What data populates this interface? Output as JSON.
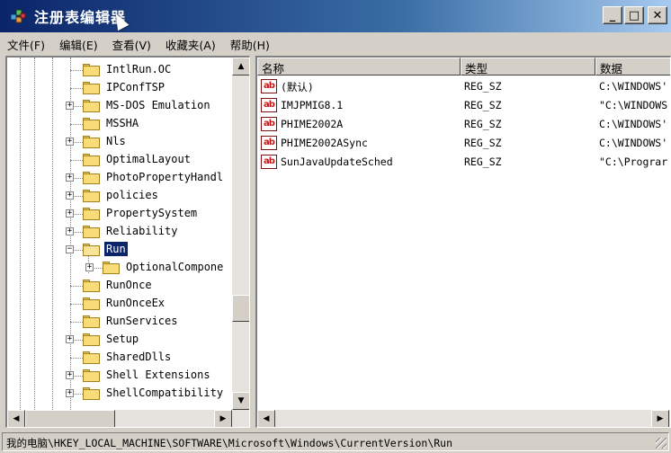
{
  "window": {
    "title": "注册表编辑器",
    "minimize_label": "_",
    "maximize_label": "□",
    "close_label": "✕"
  },
  "menu": [
    {
      "label": "文件(F)"
    },
    {
      "label": "编辑(E)"
    },
    {
      "label": "查看(V)"
    },
    {
      "label": "收藏夹(A)"
    },
    {
      "label": "帮助(H)"
    }
  ],
  "tree": {
    "items": [
      {
        "label": "IntlRun.OC",
        "expander": "",
        "depth": 0
      },
      {
        "label": "IPConfTSP",
        "expander": "",
        "depth": 0
      },
      {
        "label": "MS-DOS Emulation",
        "expander": "+",
        "depth": 0
      },
      {
        "label": "MSSHA",
        "expander": "",
        "depth": 0
      },
      {
        "label": "Nls",
        "expander": "+",
        "depth": 0
      },
      {
        "label": "OptimalLayout",
        "expander": "",
        "depth": 0
      },
      {
        "label": "PhotoPropertyHandl",
        "expander": "+",
        "depth": 0
      },
      {
        "label": "policies",
        "expander": "+",
        "depth": 0
      },
      {
        "label": "PropertySystem",
        "expander": "+",
        "depth": 0
      },
      {
        "label": "Reliability",
        "expander": "+",
        "depth": 0
      },
      {
        "label": "Run",
        "expander": "−",
        "depth": 0,
        "selected": true
      },
      {
        "label": "OptionalCompone",
        "expander": "+",
        "depth": 1
      },
      {
        "label": "RunOnce",
        "expander": "",
        "depth": 0
      },
      {
        "label": "RunOnceEx",
        "expander": "",
        "depth": 0
      },
      {
        "label": "RunServices",
        "expander": "",
        "depth": 0
      },
      {
        "label": "Setup",
        "expander": "+",
        "depth": 0
      },
      {
        "label": "SharedDlls",
        "expander": "",
        "depth": 0
      },
      {
        "label": "Shell Extensions",
        "expander": "+",
        "depth": 0
      },
      {
        "label": "ShellCompatibility",
        "expander": "+",
        "depth": 0
      }
    ]
  },
  "list": {
    "columns": [
      "名称",
      "类型",
      "数据"
    ],
    "icon_label": "ab",
    "rows": [
      {
        "name": "(默认)",
        "type": "REG_SZ",
        "data": "C:\\WINDOWS'"
      },
      {
        "name": "IMJPMIG8.1",
        "type": "REG_SZ",
        "data": "\"C:\\WINDOWS"
      },
      {
        "name": "PHIME2002A",
        "type": "REG_SZ",
        "data": "C:\\WINDOWS'"
      },
      {
        "name": "PHIME2002ASync",
        "type": "REG_SZ",
        "data": "C:\\WINDOWS'"
      },
      {
        "name": "SunJavaUpdateSched",
        "type": "REG_SZ",
        "data": "\"C:\\Prograr"
      }
    ]
  },
  "statusbar": {
    "path": "我的电脑\\HKEY_LOCAL_MACHINE\\SOFTWARE\\Microsoft\\Windows\\CurrentVersion\\Run"
  },
  "colors": {
    "title_start": "#0a246a",
    "selection": "#0a246a",
    "face": "#d4d0c8"
  }
}
